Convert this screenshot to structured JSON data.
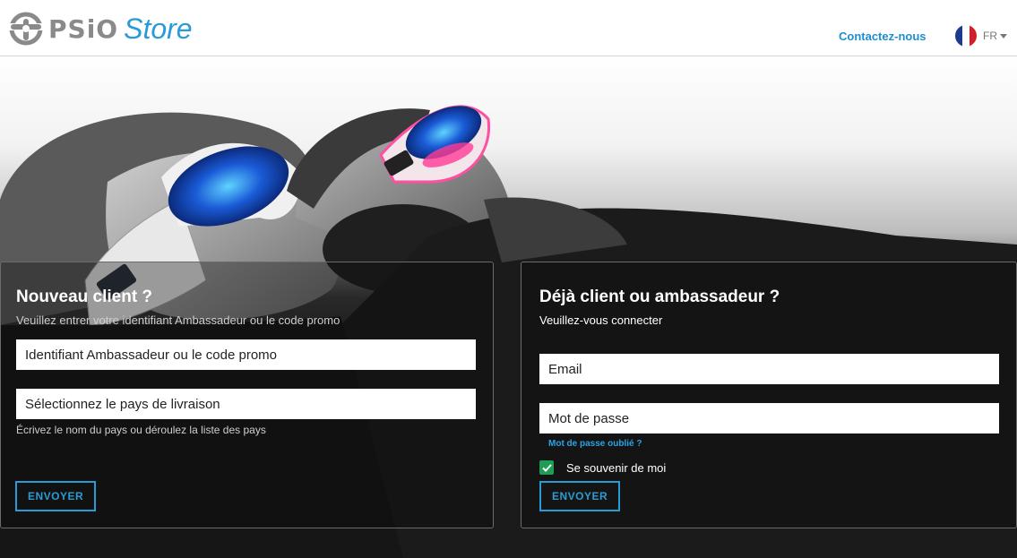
{
  "header": {
    "logo_text": "PSiO",
    "logo_store": "Store",
    "contact_label": "Contactez-nous",
    "language_code": "FR",
    "flag_colors": [
      "#1d3a8f",
      "#ffffff",
      "#d0202a"
    ]
  },
  "new_client": {
    "title": "Nouveau client ?",
    "subtitle": "Veuillez entrer votre identifiant Ambassadeur ou le code promo",
    "ambassador_placeholder": "Identifiant Ambassadeur ou le code promo",
    "country_placeholder": "Sélectionnez le pays de livraison",
    "country_hint": "Écrivez le nom du pays ou déroulez la liste des pays",
    "submit_label": "ENVOYER"
  },
  "existing_client": {
    "title": "Déjà client ou ambassadeur ?",
    "subtitle": "Veuillez-vous connecter",
    "email_placeholder": "Email",
    "password_placeholder": "Mot de passe",
    "forgot_label": "Mot de passe oublié ?",
    "remember_label": "Se souvenir de moi",
    "remember_checked": true,
    "submit_label": "ENVOYER"
  },
  "colors": {
    "accent": "#2a9bd6",
    "checkbox": "#1f9d55"
  }
}
